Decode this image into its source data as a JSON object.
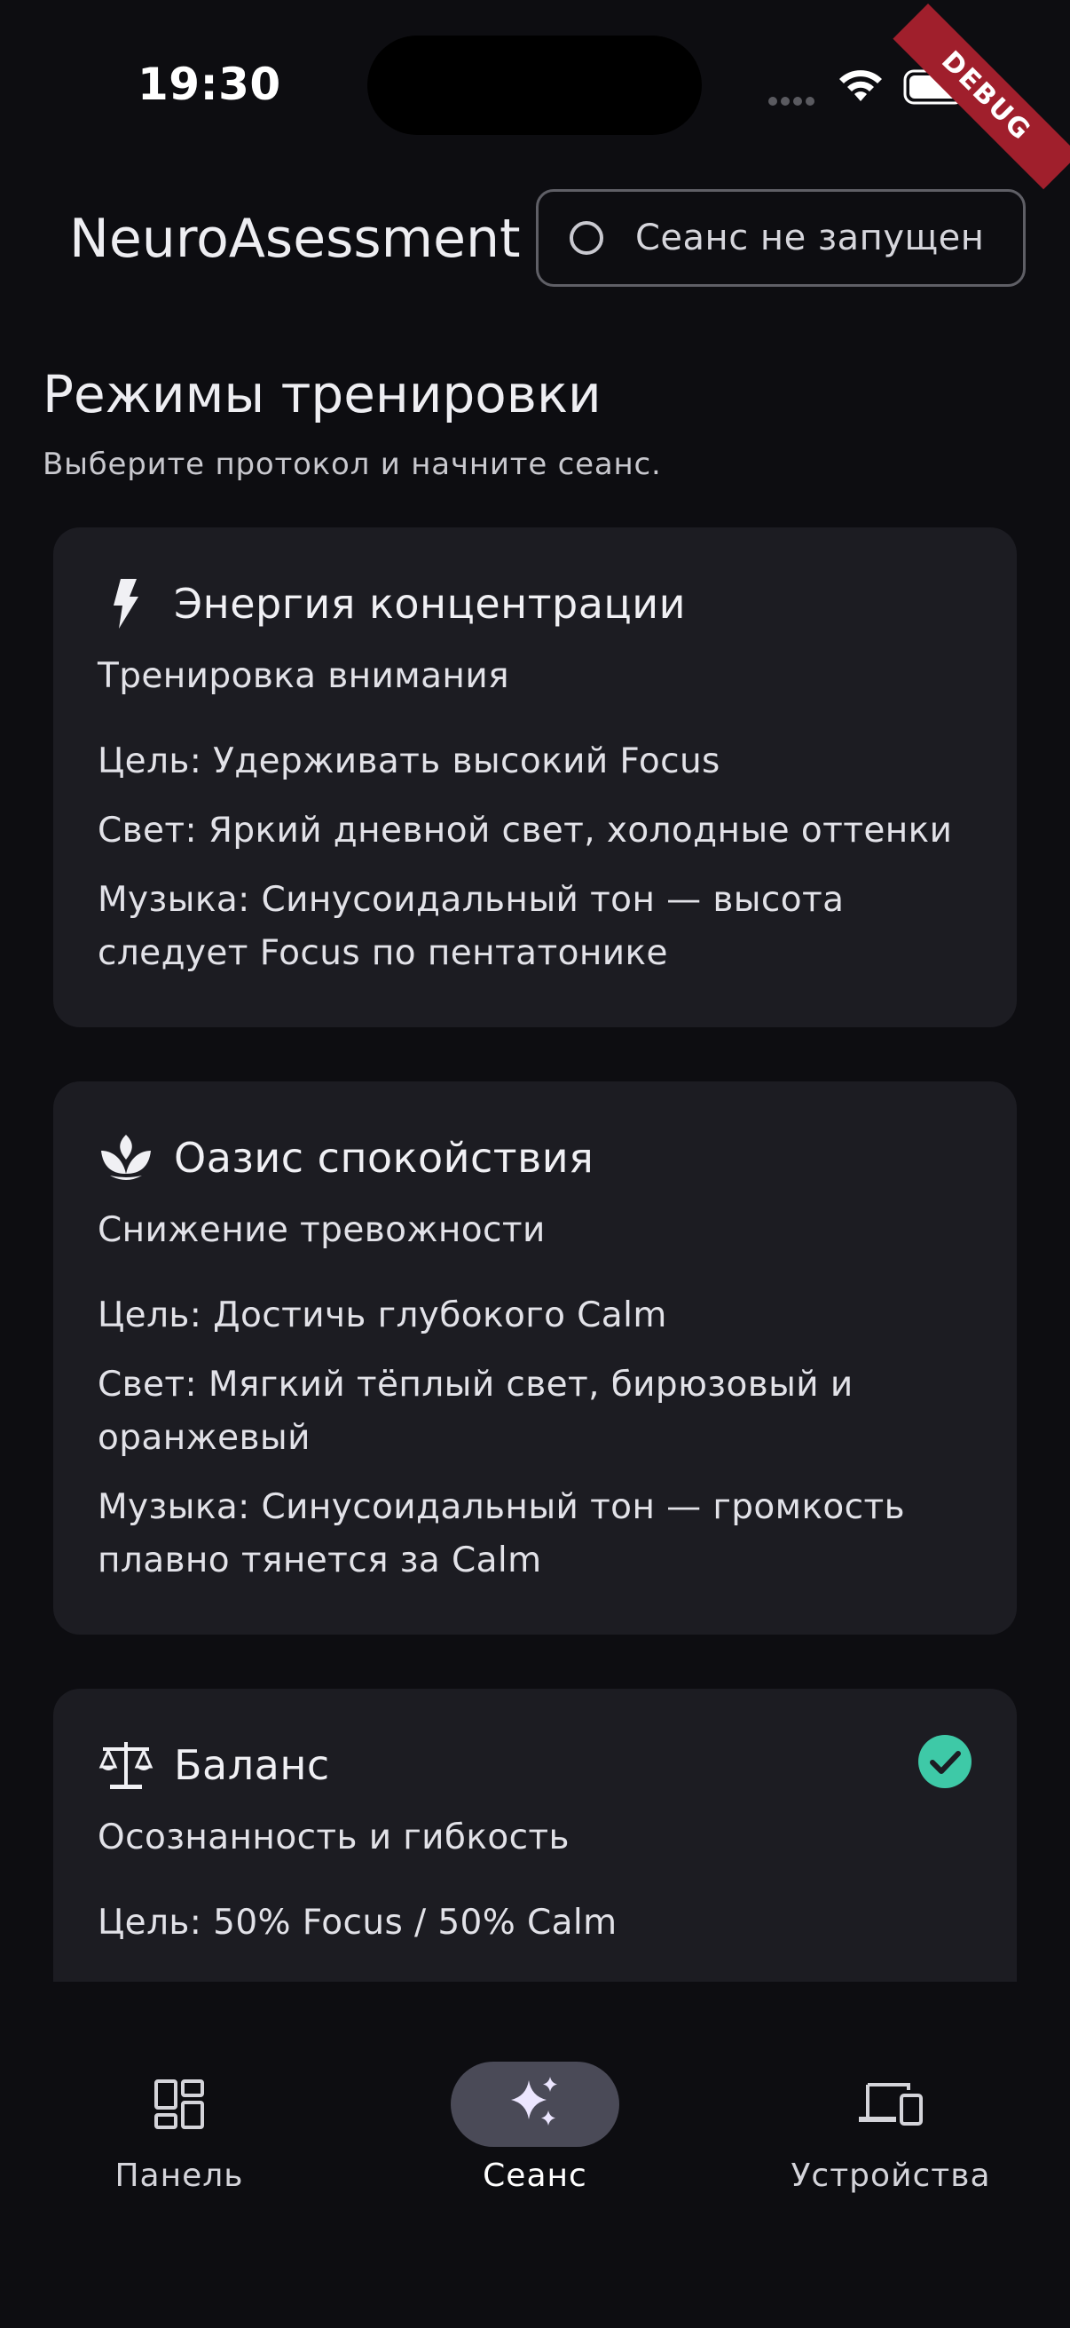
{
  "status_bar": {
    "time": "19:30",
    "debug_label": "DEBUG"
  },
  "app_bar": {
    "title": "NeuroAsessment",
    "session_status": "Сеанс не запущен"
  },
  "section": {
    "title": "Режимы тренировки",
    "subtitle": "Выберите протокол и начните сеанс."
  },
  "modes": [
    {
      "icon": "lightning-icon",
      "title": "Энергия концентрации",
      "subtitle": "Тренировка внимания",
      "goal": "Цель: Удерживать высокий Focus",
      "light": "Свет: Яркий дневной свет, холодные оттенки",
      "music": "Музыка: Синусоидальный тон — высота следует Focus по пентатонике",
      "selected": false
    },
    {
      "icon": "lotus-icon",
      "title": "Оазис спокойствия",
      "subtitle": "Снижение тревожности",
      "goal": "Цель: Достичь глубокого Calm",
      "light": "Свет: Мягкий тёплый свет, бирюзовый и оранжевый",
      "music": "Музыка: Синусоидальный тон — громкость плавно тянется за Calm",
      "selected": false
    },
    {
      "icon": "balance-scale-icon",
      "title": "Баланс",
      "subtitle": "Осознанность и гибкость",
      "goal": "Цель: 50% Focus / 50% Calm",
      "selected": true
    }
  ],
  "nav": [
    {
      "label": "Панель",
      "icon": "dashboard-icon",
      "active": false
    },
    {
      "label": "Сеанс",
      "icon": "sparkles-icon",
      "active": true
    },
    {
      "label": "Устройства",
      "icon": "devices-icon",
      "active": false
    }
  ],
  "colors": {
    "background": "#0d0d11",
    "card": "#1c1c22",
    "accent_check": "#3ec9a7",
    "nav_active_pill": "#4a4a57",
    "debug_ribbon": "#a01f2c"
  }
}
